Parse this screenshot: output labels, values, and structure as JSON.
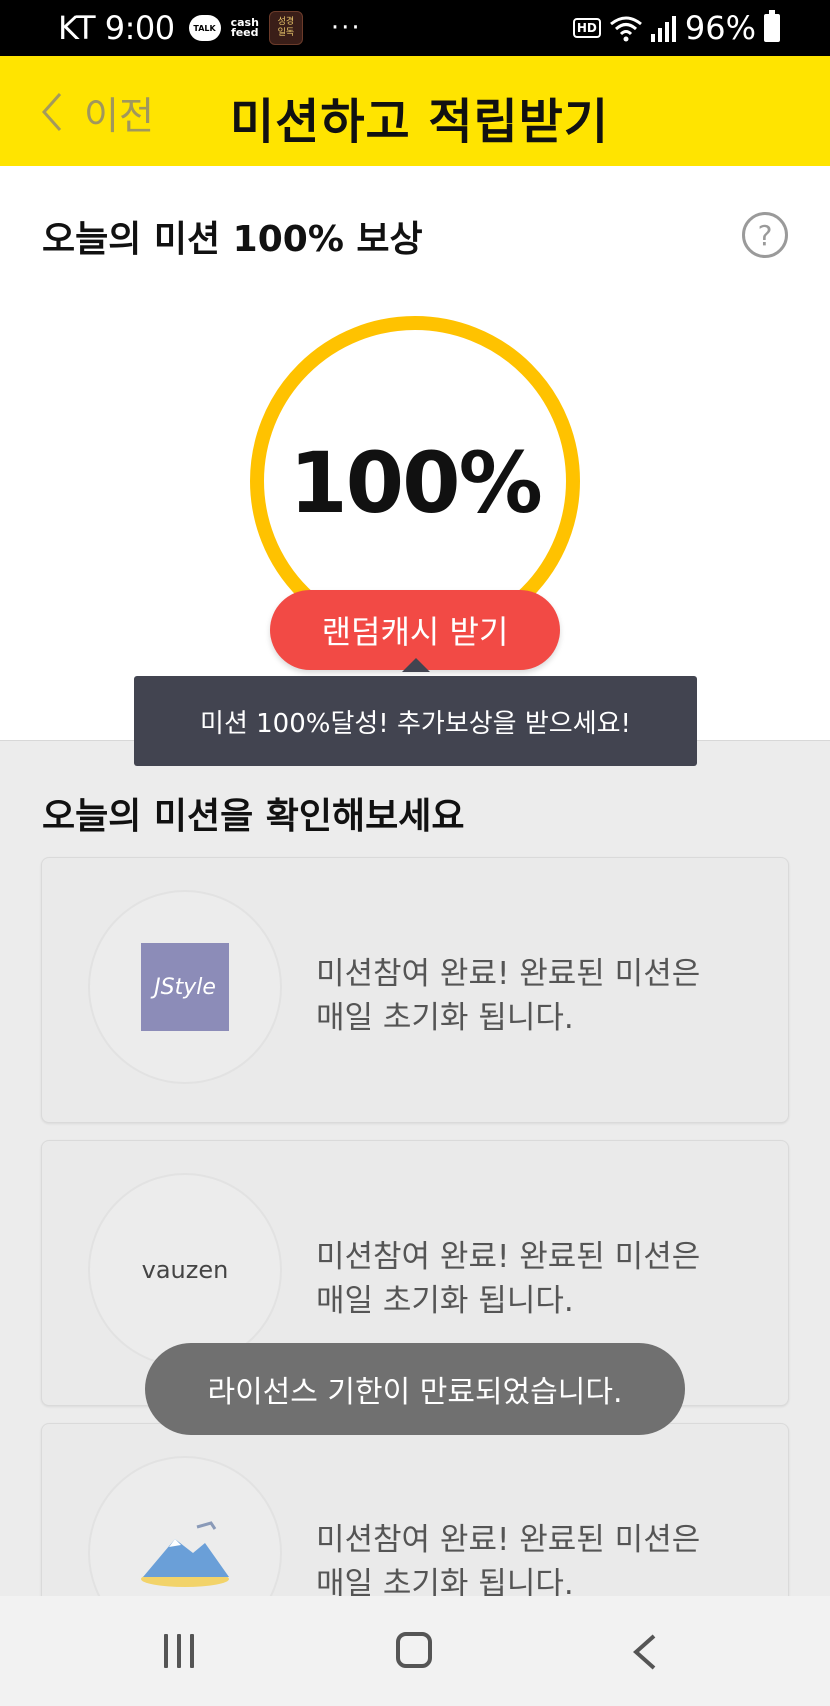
{
  "status_bar": {
    "carrier_time": "KT 9:00",
    "talk_badge": "TALK",
    "cashfeed_line1": "cash",
    "cashfeed_line2": "feed",
    "app_line1": "성경",
    "app_line2": "일독",
    "more": "···",
    "hd": "HD",
    "battery": "96%"
  },
  "header": {
    "back_label": "이전",
    "title": "미션하고 적립받기"
  },
  "reward": {
    "title": "오늘의 미션 100% 보상",
    "help": "?",
    "percent": "100%",
    "progress": 1.0,
    "button_label": "랜덤캐시 받기",
    "tooltip": "미션 100%달성! 추가보상을 받으세요!"
  },
  "missions": {
    "title": "오늘의 미션을 확인해보세요",
    "items": [
      {
        "logo": "JStyle",
        "line1": "미션참여 완료!  완료된 미션은",
        "line2": "매일 초기화 됩니다."
      },
      {
        "logo": "vauzen",
        "line1": "미션참여 완료!  완료된 미션은",
        "line2": "매일 초기화 됩니다."
      },
      {
        "logo": "",
        "line1": "미션참여 완료!  완료된 미션은",
        "line2": "매일 초기화 됩니다."
      }
    ]
  },
  "toast": "라이선스 기한이 만료되었습니다.",
  "colors": {
    "header_yellow": "#ffe400",
    "ring": "#ffc200",
    "button_red": "#f24a45",
    "tooltip_bg": "#424450"
  }
}
